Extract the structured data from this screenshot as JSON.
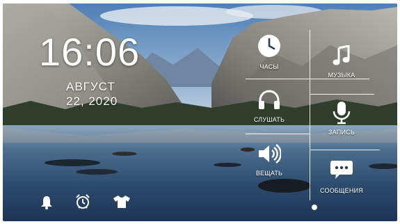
{
  "clock": {
    "time": "16:06",
    "month": "АВГУСТ",
    "day": "22, 2020"
  },
  "menu": {
    "clock_label": "ЧАСЫ",
    "listen_label": "СЛУШАТЬ",
    "broadcast_label": "ВЕЩАТЬ",
    "music_label": "МУЗЫКА",
    "record_label": "ЗАПИСЬ",
    "messages_label": "СООБЩЕНИЯ"
  },
  "icons": {
    "clock": "clock-icon",
    "listen": "headphones-icon",
    "broadcast": "speaker-icon",
    "music": "music-note-icon",
    "record": "microphone-icon",
    "messages": "chat-bubble-icon",
    "bell": "bell-icon",
    "alarm": "alarm-clock-icon",
    "shirt": "shirt-icon"
  },
  "pager": {
    "pages": 1,
    "current": 1
  },
  "colors": {
    "text": "#ffffff",
    "sky": "#5f8fc2",
    "water": "#27486e"
  }
}
